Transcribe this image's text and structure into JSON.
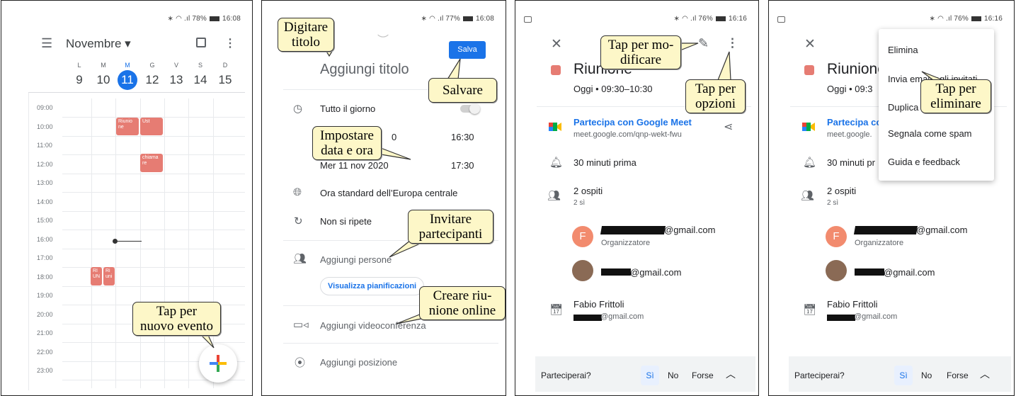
{
  "p1": {
    "status": "78%",
    "time": "16:08",
    "month": "Novembre",
    "days": [
      {
        "l": "L",
        "n": "9"
      },
      {
        "l": "M",
        "n": "10"
      },
      {
        "l": "M",
        "n": "11"
      },
      {
        "l": "G",
        "n": "12"
      },
      {
        "l": "V",
        "n": "13"
      },
      {
        "l": "S",
        "n": "14"
      },
      {
        "l": "D",
        "n": "15"
      }
    ],
    "hours": [
      "09:00",
      "10:00",
      "11:00",
      "12:00",
      "13:00",
      "14:00",
      "15:00",
      "16:00",
      "17:00",
      "18:00",
      "19:00",
      "20:00",
      "21:00",
      "22:00",
      "23:00"
    ],
    "ev1": "Riunio ne",
    "ev2": "Ust",
    "ev3": "chiama re",
    "ev4": "RI UN",
    "ev5": "Ri uni",
    "callout": [
      "Tap per",
      "nuovo evento"
    ]
  },
  "p2": {
    "status": "77%",
    "time": "16:08",
    "save": "Salva",
    "title_placeholder": "Aggiungi titolo",
    "allday": "Tutto il giorno",
    "start_date_partial": "0",
    "start_time": "16:30",
    "end_date": "Mer 11 nov 2020",
    "end_time": "17:30",
    "timezone": "Ora standard dell’Europa centrale",
    "repeat": "Non si ripete",
    "people": "Aggiungi persone",
    "schedules": "Visualizza pianificazioni",
    "video": "Aggiungi videoconferenza",
    "location": "Aggiungi posizione",
    "c_title": [
      "Digitare",
      "titolo"
    ],
    "c_save": [
      "Salvare"
    ],
    "c_date": [
      "Impostare",
      "data e ora"
    ],
    "c_invite": [
      "Invitare",
      "partecipanti"
    ],
    "c_meet": [
      "Creare riu-",
      "nione online"
    ]
  },
  "p3": {
    "status": "76%",
    "time": "16:16",
    "title": "Riunione",
    "when": "Oggi  •  09:30–10:30",
    "meet": "Partecipa con Google Meet",
    "meet_url": "meet.google.com/qnp-wekt-fwu",
    "reminder": "30 minuti prima",
    "guests": "2 ospiti",
    "yes": "2 sì",
    "g1_mail": "@gmail.com",
    "g1_role": "Organizzatore",
    "g1_initial": "F",
    "g2_mail": "@gmail.com",
    "owner": "Fabio Frittoli",
    "owner_mail": "@gmail.com",
    "rsvp": "Parteciperai?",
    "si": "Sì",
    "no": "No",
    "forse": "Forse",
    "c_edit": [
      "Tap per mo-",
      "dificare"
    ],
    "c_opts": [
      "Tap per",
      "opzioni"
    ]
  },
  "p4": {
    "status": "76%",
    "time": "16:16",
    "title": "Riunione",
    "when": "Oggi  •  09:3",
    "meet": "Partecipa co",
    "meet_url": "meet.google.",
    "reminder": "30 minuti pr",
    "guests": "2 ospiti",
    "yes": "2 sì",
    "g1_mail": "@gmail.com",
    "g1_role": "Organizzatore",
    "g1_initial": "F",
    "g2_mail": "@gmail.com",
    "owner": "Fabio Frittoli",
    "owner_mail": "@gmail.com",
    "rsvp": "Parteciperai?",
    "si": "Sì",
    "no": "No",
    "forse": "Forse",
    "menu": [
      "Elimina",
      "Invia email agli invitati",
      "Duplica",
      "Segnala come spam",
      "Guida e feedback"
    ],
    "c_delete": [
      "Tap per",
      "eliminare"
    ]
  }
}
